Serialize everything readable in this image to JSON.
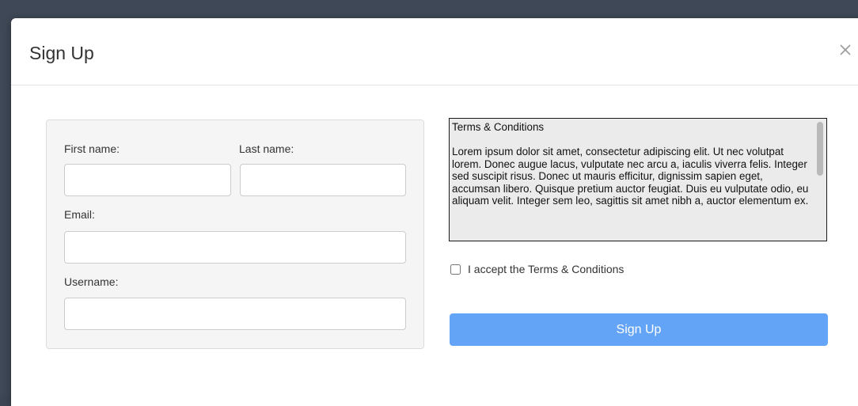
{
  "modal": {
    "title": "Sign Up",
    "close_icon": "close-icon"
  },
  "form": {
    "first_name": {
      "label": "First name:",
      "value": ""
    },
    "last_name": {
      "label": "Last name:",
      "value": ""
    },
    "email": {
      "label": "Email:",
      "value": ""
    },
    "username": {
      "label": "Username:",
      "value": ""
    }
  },
  "terms": {
    "text": "Terms & Conditions\n\nLorem ipsum dolor sit amet, consectetur adipiscing elit. Ut nec volutpat lorem. Donec augue lacus, vulputate nec arcu a, iaculis viverra felis. Integer sed suscipit risus. Donec ut mauris efficitur, dignissim sapien eget, accumsan libero. Quisque pretium auctor feugiat. Duis eu vulputate odio, eu aliquam velit. Integer sem leo, sagittis sit amet nibh a, auctor elementum ex.",
    "accept_label": "I accept the Terms & Conditions",
    "accepted": false
  },
  "actions": {
    "submit_label": "Sign Up"
  },
  "colors": {
    "primary_button": "#64a4f6",
    "backdrop": "#3f4856",
    "panel_background": "#f5f5f5"
  }
}
